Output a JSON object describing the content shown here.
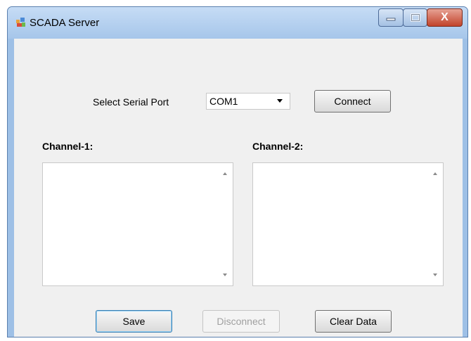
{
  "window": {
    "title": "SCADA Server"
  },
  "controls": {
    "close_glyph": "X"
  },
  "serial": {
    "label": "Select Serial Port",
    "selected_port": "COM1",
    "connect_label": "Connect"
  },
  "channels": {
    "channel1_label": "Channel-1:",
    "channel2_label": "Channel-2:"
  },
  "buttons": {
    "save": "Save",
    "disconnect": "Disconnect",
    "clear_data": "Clear Data"
  },
  "colors": {
    "title_bar": "#a6c6ea",
    "close_button": "#c2432b",
    "client_background": "#f0f0f0"
  }
}
